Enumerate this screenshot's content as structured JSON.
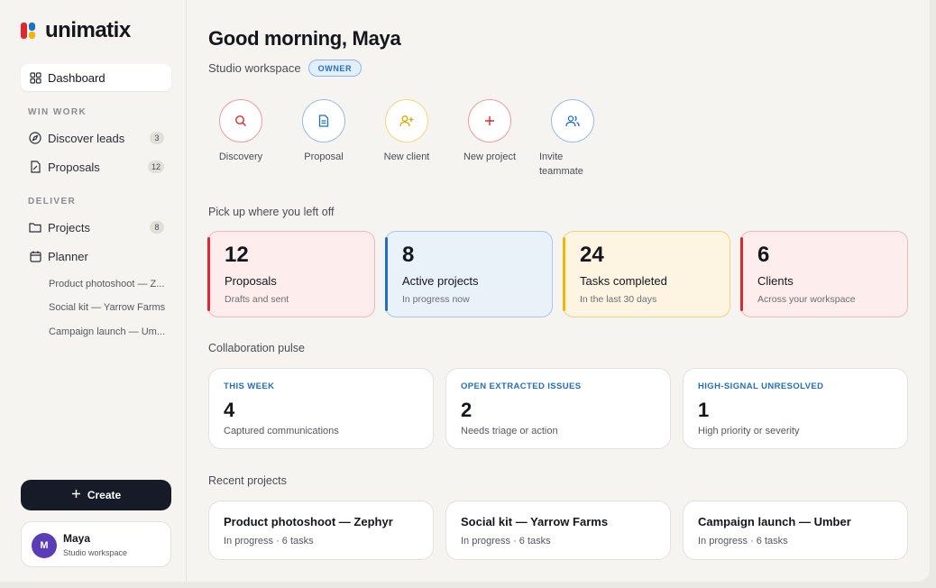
{
  "brand": {
    "name": "unimatix"
  },
  "sidebar": {
    "dashboard": {
      "label": "Dashboard"
    },
    "sections": {
      "win_work": "WIN WORK",
      "deliver": "DELIVER"
    },
    "items": [
      {
        "label": "Discover leads",
        "count": "3"
      },
      {
        "label": "Proposals",
        "count": "12"
      },
      {
        "label": "Projects",
        "count": "8"
      },
      {
        "label": "Planner"
      }
    ],
    "planner_items": [
      "Product photoshoot — Z...",
      "Social kit — Yarrow Farms",
      "Campaign launch — Um..."
    ],
    "create_label": "Create",
    "user": {
      "initial": "M",
      "name": "Maya",
      "workspace": "Studio workspace"
    }
  },
  "main": {
    "greeting": "Good morning, Maya",
    "workspace": "Studio workspace",
    "role_badge": "OWNER",
    "quick_actions": [
      {
        "label": "Discovery",
        "icon": "search-icon"
      },
      {
        "label": "Proposal",
        "icon": "document-icon"
      },
      {
        "label": "New client",
        "icon": "user-plus-icon"
      },
      {
        "label": "New project",
        "icon": "plus-icon"
      },
      {
        "label": "Invite teammate",
        "icon": "users-icon"
      }
    ],
    "pickup_title": "Pick up where you left off",
    "stats": [
      {
        "value": "12",
        "title": "Proposals",
        "sub": "Drafts and sent"
      },
      {
        "value": "8",
        "title": "Active projects",
        "sub": "In progress now"
      },
      {
        "value": "24",
        "title": "Tasks completed",
        "sub": "In the last 30 days"
      },
      {
        "value": "6",
        "title": "Clients",
        "sub": "Across your workspace"
      }
    ],
    "pulse_title": "Collaboration pulse",
    "pulse": [
      {
        "label": "THIS WEEK",
        "value": "4",
        "sub": "Captured communications"
      },
      {
        "label": "OPEN EXTRACTED ISSUES",
        "value": "2",
        "sub": "Needs triage or action"
      },
      {
        "label": "HIGH-SIGNAL UNRESOLVED",
        "value": "1",
        "sub": "High priority or severity"
      }
    ],
    "recent_title": "Recent projects",
    "recent_projects": [
      {
        "title": "Product photoshoot — Zephyr",
        "status": "In progress · 6 tasks"
      },
      {
        "title": "Social kit — Yarrow Farms",
        "status": "In progress · 6 tasks"
      },
      {
        "title": "Campaign launch — Umber",
        "status": "In progress · 6 tasks"
      }
    ]
  },
  "colors": {
    "red": "#e0262f",
    "blue": "#1f6fc4",
    "yellow": "#f2b705",
    "dark": "#171b27",
    "avatar": "#5b3db8"
  }
}
